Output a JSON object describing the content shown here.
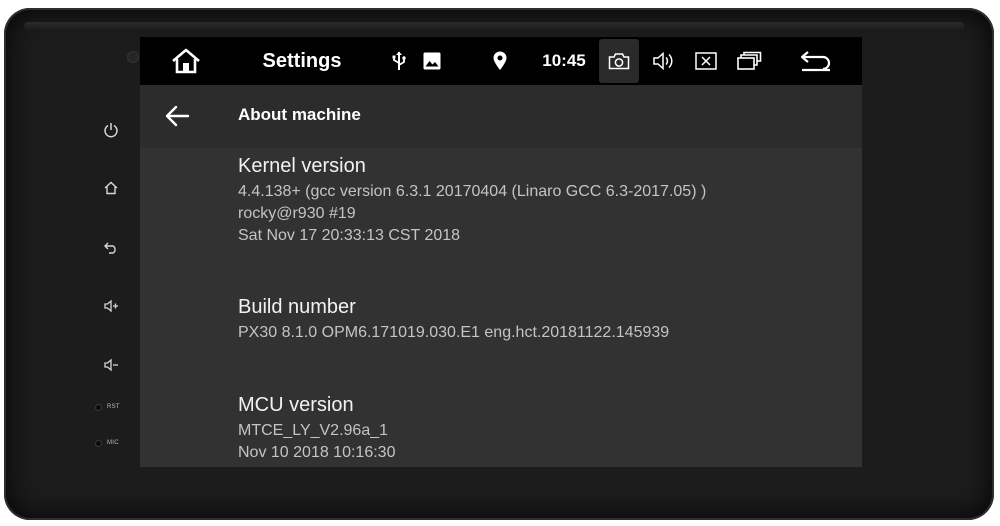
{
  "statusbar": {
    "title": "Settings",
    "time": "10:45",
    "icons": [
      "home-icon",
      "usb-icon",
      "image-icon",
      "location-icon",
      "screenshot-icon",
      "volume-icon",
      "close-app-icon",
      "recent-apps-icon",
      "back-icon"
    ]
  },
  "appbar": {
    "title": "About machine"
  },
  "prefs": {
    "kernel": {
      "title": "Kernel version",
      "line1": "4.4.138+ (gcc version 6.3.1 20170404 (Linaro GCC 6.3-2017.05) )",
      "line2": "rocky@r930 #19",
      "line3": "Sat Nov 17 20:33:13 CST 2018"
    },
    "build": {
      "title": "Build number",
      "line1": "PX30 8.1.0 OPM6.171019.030.E1 eng.hct.20181122.145939"
    },
    "mcu": {
      "title": "MCU version",
      "line1": "MTCE_LY_V2.96a_1",
      "line2": "Nov 10 2018 10:16:30"
    }
  },
  "bezel": {
    "rst_label": "RST",
    "mic_label": "MIC"
  }
}
